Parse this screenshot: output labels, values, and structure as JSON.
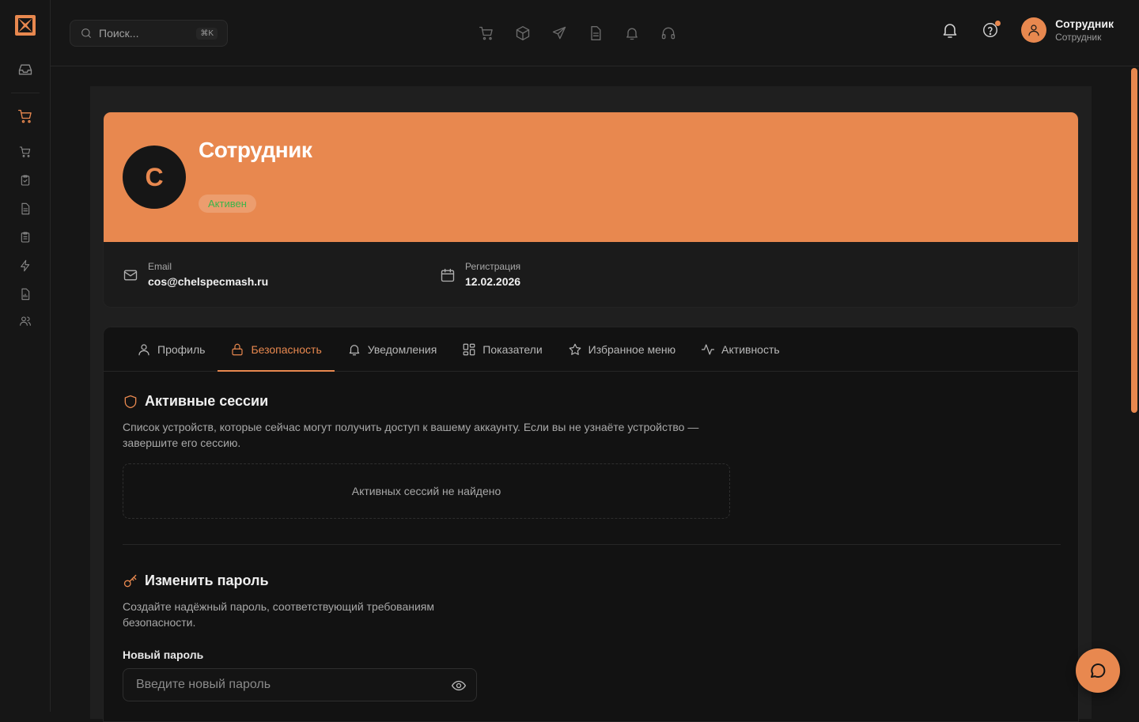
{
  "search": {
    "placeholder": "Поиск...",
    "shortcut": "⌘K"
  },
  "user": {
    "name": "Сотрудник",
    "role": "Сотрудник"
  },
  "profile": {
    "initial": "С",
    "name": "Сотрудник",
    "status": "Активен",
    "email_label": "Email",
    "email": "cos@chelspecmash.ru",
    "reg_label": "Регистрация",
    "reg_date": "12.02.2026"
  },
  "tabs": [
    {
      "label": "Профиль",
      "icon": "user-icon"
    },
    {
      "label": "Безопасность",
      "icon": "lock-icon",
      "active": true
    },
    {
      "label": "Уведомления",
      "icon": "bell-icon"
    },
    {
      "label": "Показатели",
      "icon": "grid-icon"
    },
    {
      "label": "Избранное меню",
      "icon": "star-icon"
    },
    {
      "label": "Активность",
      "icon": "activity-icon"
    }
  ],
  "sessions": {
    "title": "Активные сессии",
    "desc": "Список устройств, которые сейчас могут получить доступ к вашему аккаунту. Если вы не узнаёте устройство — завершите его сессию.",
    "empty": "Активных сессий не найдено"
  },
  "password": {
    "title": "Изменить пароль",
    "desc": "Создайте надёжный пароль, соответствующий требованиям безопасности.",
    "new_label": "Новый пароль",
    "new_placeholder": "Введите новый пароль"
  },
  "colors": {
    "accent": "#e8884f",
    "status_green": "#3cb54a",
    "bg": "#161616"
  }
}
